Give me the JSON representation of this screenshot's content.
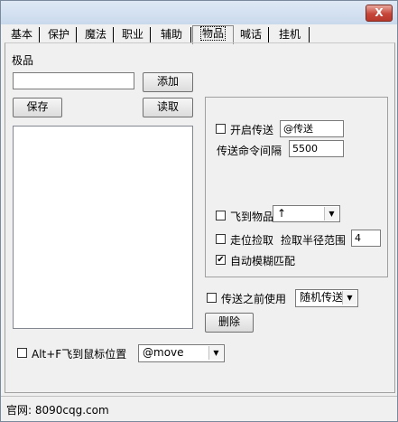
{
  "window": {
    "close_label": "X"
  },
  "tabs": [
    {
      "label": "基本"
    },
    {
      "label": "保护"
    },
    {
      "label": "魔法"
    },
    {
      "label": "职业"
    },
    {
      "label": "辅助"
    },
    {
      "label": "物品"
    },
    {
      "label": "喊话"
    },
    {
      "label": "挂机"
    }
  ],
  "left": {
    "title": "极品",
    "item_input_value": "",
    "add_label": "添加",
    "save_label": "保存",
    "read_label": "读取",
    "list_items": []
  },
  "teleport": {
    "enable_label": "开启传送",
    "enable_checked": false,
    "command_value": "@传送",
    "interval_label": "传送命令间隔",
    "interval_value": "5500"
  },
  "fly": {
    "label": "飞到物品",
    "checked": false,
    "combo_value": "↑"
  },
  "pickup": {
    "walk_label": "走位捡取",
    "walk_checked": false,
    "radius_label": "捡取半径范围",
    "radius_value": "4",
    "fuzzy_label": "自动模糊匹配",
    "fuzzy_checked": true
  },
  "before_teleport": {
    "label": "传送之前使用",
    "checked": false,
    "combo_value": "随机传送",
    "delete_label": "删除"
  },
  "bottom": {
    "mouse_label": "Alt+F飞到鼠标位置",
    "mouse_checked": false,
    "move_value": "@move"
  },
  "status": {
    "text": "官网: 8090cqg.com"
  }
}
